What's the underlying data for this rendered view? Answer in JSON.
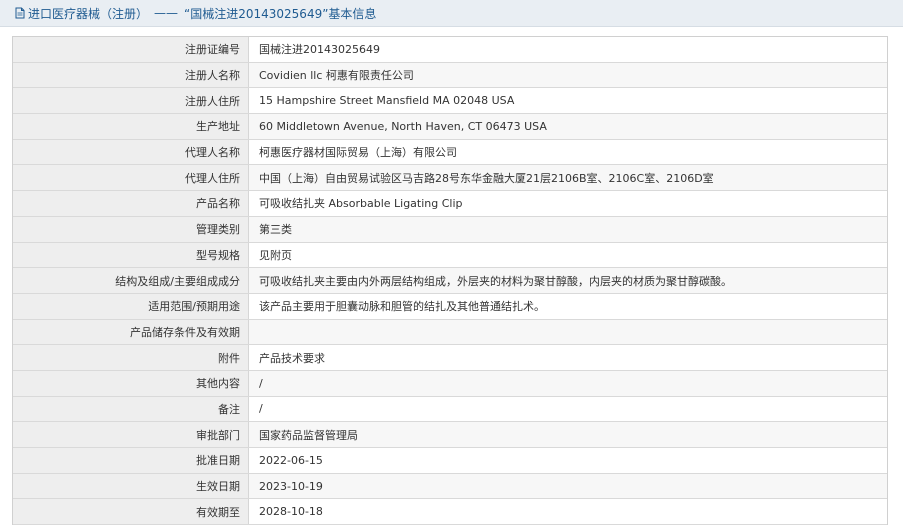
{
  "header": {
    "icon": "document-icon",
    "category": "进口医疗器械（注册）",
    "separator": "——",
    "record_title": "“国械注进20143025649”基本信息"
  },
  "rows": [
    {
      "label": "注册证编号",
      "value": "国械注进20143025649"
    },
    {
      "label": "注册人名称",
      "value": "Covidien llc 柯惠有限责任公司"
    },
    {
      "label": "注册人住所",
      "value": "15 Hampshire Street Mansfield MA 02048 USA"
    },
    {
      "label": "生产地址",
      "value": "60 Middletown Avenue, North Haven, CT 06473 USA"
    },
    {
      "label": "代理人名称",
      "value": "柯惠医疗器材国际贸易（上海）有限公司"
    },
    {
      "label": "代理人住所",
      "value": "中国（上海）自由贸易试验区马吉路28号东华金融大厦21层2106B室、2106C室、2106D室"
    },
    {
      "label": "产品名称",
      "value": "可吸收结扎夹 Absorbable Ligating Clip"
    },
    {
      "label": "管理类别",
      "value": "第三类"
    },
    {
      "label": "型号规格",
      "value": "见附页"
    },
    {
      "label": "结构及组成/主要组成成分",
      "value": "可吸收结扎夹主要由内外两层结构组成，外层夹的材料为聚甘醇酸，内层夹的材质为聚甘醇碳酸。"
    },
    {
      "label": "适用范围/预期用途",
      "value": "该产品主要用于胆囊动脉和胆管的结扎及其他普通结扎术。"
    },
    {
      "label": "产品储存条件及有效期",
      "value": ""
    },
    {
      "label": "附件",
      "value": "产品技术要求"
    },
    {
      "label": "其他内容",
      "value": "/"
    },
    {
      "label": "备注",
      "value": "/"
    },
    {
      "label": "审批部门",
      "value": "国家药品监督管理局"
    },
    {
      "label": "批准日期",
      "value": "2022-06-15"
    },
    {
      "label": "生效日期",
      "value": "2023-10-19"
    },
    {
      "label": "有效期至",
      "value": "2028-10-18"
    }
  ]
}
